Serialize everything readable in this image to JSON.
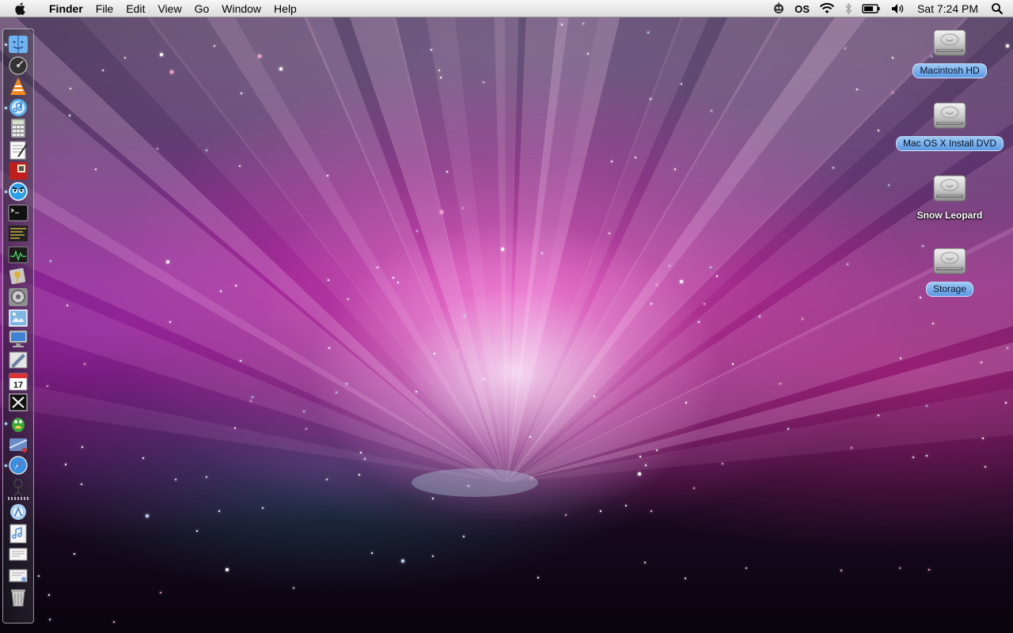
{
  "menubar": {
    "app_name": "Finder",
    "menus": [
      "File",
      "Edit",
      "View",
      "Go",
      "Window",
      "Help"
    ],
    "status": {
      "os_label": "OS",
      "clock": "Sat 7:24 PM"
    }
  },
  "dock": {
    "items": [
      {
        "name": "finder-icon",
        "running": true
      },
      {
        "name": "dashboard-icon",
        "running": false
      },
      {
        "name": "vlc-icon",
        "running": false
      },
      {
        "name": "itunes-icon",
        "running": true
      },
      {
        "name": "calculator-icon",
        "running": false
      },
      {
        "name": "textedit-icon",
        "running": false
      },
      {
        "name": "photo-booth-icon",
        "running": false
      },
      {
        "name": "tweetie-icon",
        "running": true
      },
      {
        "name": "terminal-icon",
        "running": false
      },
      {
        "name": "console-icon",
        "running": false
      },
      {
        "name": "activity-monitor-icon",
        "running": false
      },
      {
        "name": "keychain-icon",
        "running": false
      },
      {
        "name": "system-preferences-icon",
        "running": false
      },
      {
        "name": "preview-icon",
        "running": false
      },
      {
        "name": "remote-desktop-icon",
        "running": false
      },
      {
        "name": "image-capture-icon",
        "running": false
      },
      {
        "name": "ical-icon",
        "running": false
      },
      {
        "name": "x11-icon",
        "running": false
      },
      {
        "name": "adium-icon",
        "running": true
      },
      {
        "name": "directory-icon",
        "running": false
      },
      {
        "name": "safari-icon",
        "running": true
      },
      {
        "name": "automator-icon",
        "running": false
      },
      {
        "name": "applications-stack-icon",
        "running": false
      },
      {
        "name": "music-stack-icon",
        "running": false
      },
      {
        "name": "documents-stack-icon",
        "running": false
      },
      {
        "name": "downloads-stack-icon",
        "running": false
      },
      {
        "name": "trash-icon",
        "running": false
      }
    ]
  },
  "desktop": {
    "drives": [
      {
        "label": "Macintosh HD",
        "selected": true
      },
      {
        "label": "Mac OS X Install DVD",
        "selected": true
      },
      {
        "label": "Snow Leopard",
        "selected": false
      },
      {
        "label": "Storage",
        "selected": true
      }
    ]
  },
  "colors": {
    "selection_label": "#6aa7ea",
    "menubar": "#e8e8e8",
    "wallpaper_core": "#ff8ce0"
  }
}
